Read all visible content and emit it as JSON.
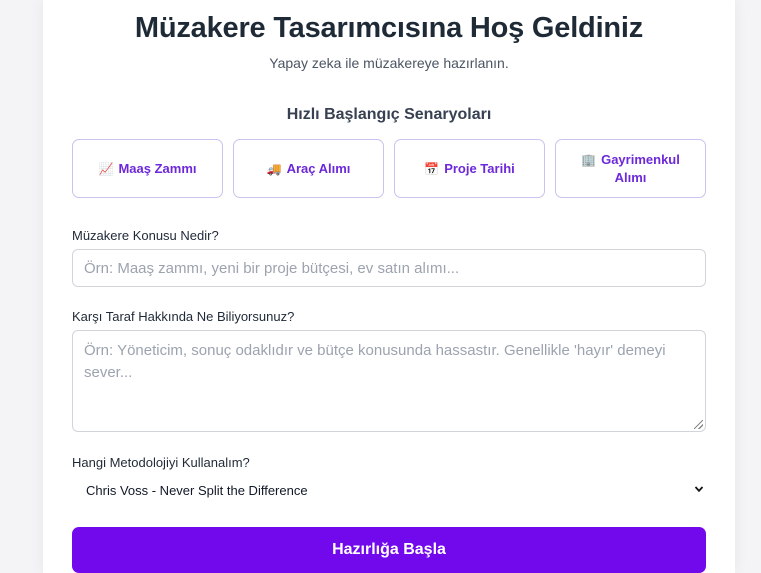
{
  "header": {
    "title": "Müzakere Tasarımcısına Hoş Geldiniz",
    "subtitle": "Yapay zeka ile müzakereye hazırlanın."
  },
  "quick_start": {
    "title": "Hızlı Başlangıç Senaryoları",
    "scenarios": [
      {
        "icon": "chart-increasing-icon",
        "glyph": "📈",
        "label": "Maaş Zammı"
      },
      {
        "icon": "truck-icon",
        "glyph": "🚚",
        "label": "Araç Alımı"
      },
      {
        "icon": "calendar-icon",
        "glyph": "📅",
        "label": "Proje Tarihi"
      },
      {
        "icon": "office-building-icon",
        "glyph": "🏢",
        "label": "Gayrimenkul Alımı"
      }
    ]
  },
  "form": {
    "topic": {
      "label": "Müzakere Konusu Nedir?",
      "value": "",
      "placeholder": "Örn: Maaş zammı, yeni bir proje bütçesi, ev satın alımı..."
    },
    "counterparty": {
      "label": "Karşı Taraf Hakkında Ne Biliyorsunuz?",
      "value": "",
      "placeholder": "Örn: Yöneticim, sonuç odaklıdır ve bütçe konusunda hassastır. Genellikle 'hayır' demeyi sever..."
    },
    "methodology": {
      "label": "Hangi Metodolojiyi Kullanalım?",
      "selected": "Chris Voss - Never Split the Difference"
    },
    "submit_label": "Hazırlığa Başla"
  },
  "colors": {
    "primary": "#7209ed",
    "accent_text": "#6d28d9",
    "border": "#c7c4f0"
  }
}
